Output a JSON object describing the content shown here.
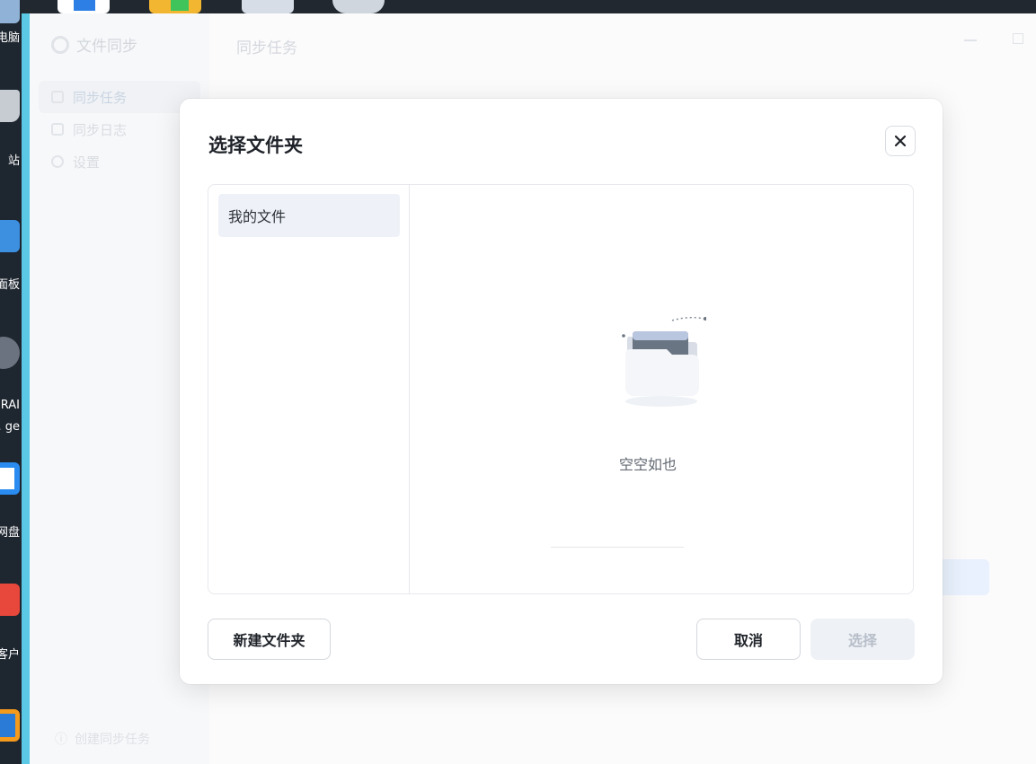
{
  "desktop": {
    "icons": [
      {
        "caption": "电脑",
        "icon": "computer-icon",
        "color": "#8fb2d6"
      },
      {
        "caption": "站",
        "icon": "recycle-bin-icon",
        "color": "#c7ccd2"
      },
      {
        "caption": "面板",
        "icon": "control-panel-icon",
        "color": "#3d8fe0"
      },
      {
        "caption": "RAI",
        "icon": "storage-app-icon",
        "color": "#6c7380"
      },
      {
        "caption": "ge .",
        "icon": "storage-app-sub-icon",
        "color": "#6c7380"
      },
      {
        "caption": "网盘",
        "icon": "cloud-drive-icon",
        "color": "#2a8cf0"
      },
      {
        "caption": "客户",
        "icon": "client-app-icon",
        "color": "#e8473b"
      },
      {
        "caption": "",
        "icon": "orange-app-icon",
        "color": "#f49a1c"
      }
    ],
    "top_apps": [
      {
        "icon": "blue-app-shortcut-icon",
        "color": "#2d7fe5"
      },
      {
        "icon": "colorful-app-shortcut-icon",
        "color": "#f2b630"
      },
      {
        "icon": "network-app-shortcut-icon",
        "color": "#7a8aa0"
      },
      {
        "icon": "circle-app-shortcut-icon",
        "color": "#d0d6de"
      }
    ]
  },
  "background_app": {
    "title": "文件同步",
    "tab_title": "同步任务",
    "nav": [
      {
        "label": "同步任务",
        "icon": "sync-task-icon",
        "active": true
      },
      {
        "label": "同步日志",
        "icon": "log-icon",
        "active": false
      },
      {
        "label": "设置",
        "icon": "settings-icon",
        "active": false
      }
    ],
    "bottom_link": "创建同步任务"
  },
  "dialog": {
    "title": "选择文件夹",
    "close_icon": "close-icon",
    "tree": {
      "root_label": "我的文件"
    },
    "empty_state": {
      "text": "空空如也",
      "icon": "empty-folder-icon"
    },
    "buttons": {
      "new_folder": "新建文件夹",
      "cancel": "取消",
      "select": "选择"
    }
  },
  "colors": {
    "accent_cyan": "#5bc9e6",
    "select_disabled_bg": "#eef1f6",
    "tree_selected_bg": "#eef2f8"
  }
}
